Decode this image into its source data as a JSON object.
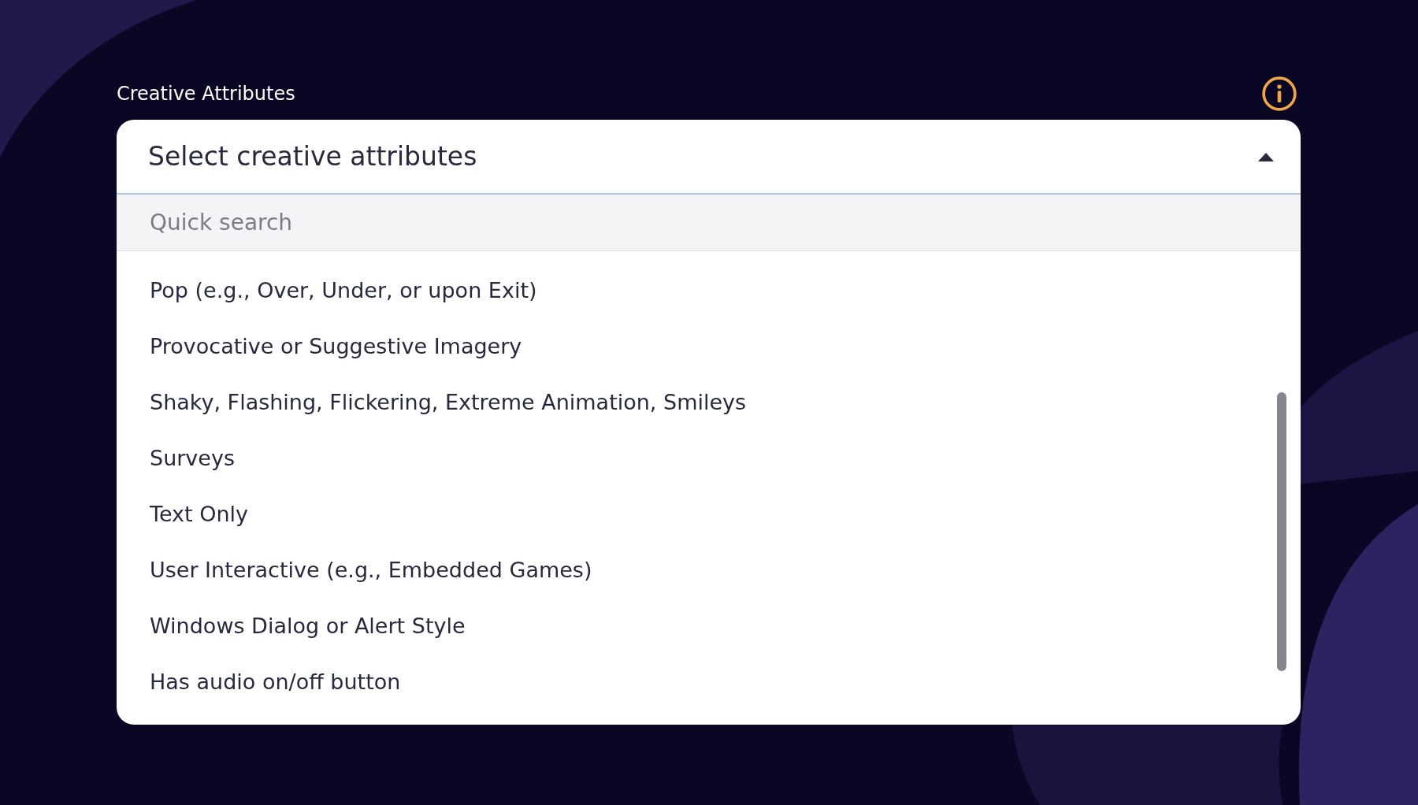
{
  "field": {
    "label": "Creative Attributes",
    "dropdown": {
      "placeholder": "Select creative attributes",
      "expanded": true
    },
    "search": {
      "placeholder": "Quick search"
    },
    "options": [
      {
        "label": "Pop (e.g., Over, Under, or upon Exit)"
      },
      {
        "label": "Provocative or Suggestive Imagery"
      },
      {
        "label": "Shaky, Flashing, Flickering, Extreme Animation, Smileys"
      },
      {
        "label": "Surveys"
      },
      {
        "label": "Text Only"
      },
      {
        "label": "User Interactive (e.g., Embedded Games)"
      },
      {
        "label": "Windows Dialog or Alert Style"
      },
      {
        "label": "Has audio on/off button"
      }
    ]
  }
}
